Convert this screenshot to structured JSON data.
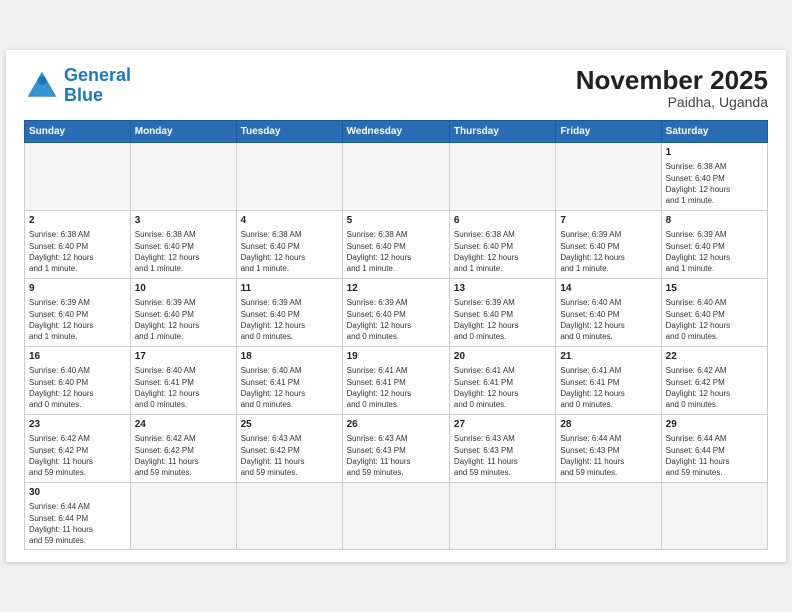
{
  "header": {
    "logo_general": "General",
    "logo_blue": "Blue",
    "title": "November 2025",
    "subtitle": "Paidha, Uganda"
  },
  "weekdays": [
    "Sunday",
    "Monday",
    "Tuesday",
    "Wednesday",
    "Thursday",
    "Friday",
    "Saturday"
  ],
  "weeks": [
    [
      {
        "day": "",
        "text": ""
      },
      {
        "day": "",
        "text": ""
      },
      {
        "day": "",
        "text": ""
      },
      {
        "day": "",
        "text": ""
      },
      {
        "day": "",
        "text": ""
      },
      {
        "day": "",
        "text": ""
      },
      {
        "day": "1",
        "text": "Sunrise: 6:38 AM\nSunset: 6:40 PM\nDaylight: 12 hours\nand 1 minute."
      }
    ],
    [
      {
        "day": "2",
        "text": "Sunrise: 6:38 AM\nSunset: 6:40 PM\nDaylight: 12 hours\nand 1 minute."
      },
      {
        "day": "3",
        "text": "Sunrise: 6:38 AM\nSunset: 6:40 PM\nDaylight: 12 hours\nand 1 minute."
      },
      {
        "day": "4",
        "text": "Sunrise: 6:38 AM\nSunset: 6:40 PM\nDaylight: 12 hours\nand 1 minute."
      },
      {
        "day": "5",
        "text": "Sunrise: 6:38 AM\nSunset: 6:40 PM\nDaylight: 12 hours\nand 1 minute."
      },
      {
        "day": "6",
        "text": "Sunrise: 6:38 AM\nSunset: 6:40 PM\nDaylight: 12 hours\nand 1 minute."
      },
      {
        "day": "7",
        "text": "Sunrise: 6:39 AM\nSunset: 6:40 PM\nDaylight: 12 hours\nand 1 minute."
      },
      {
        "day": "8",
        "text": "Sunrise: 6:39 AM\nSunset: 6:40 PM\nDaylight: 12 hours\nand 1 minute."
      }
    ],
    [
      {
        "day": "9",
        "text": "Sunrise: 6:39 AM\nSunset: 6:40 PM\nDaylight: 12 hours\nand 1 minute."
      },
      {
        "day": "10",
        "text": "Sunrise: 6:39 AM\nSunset: 6:40 PM\nDaylight: 12 hours\nand 1 minute."
      },
      {
        "day": "11",
        "text": "Sunrise: 6:39 AM\nSunset: 6:40 PM\nDaylight: 12 hours\nand 0 minutes."
      },
      {
        "day": "12",
        "text": "Sunrise: 6:39 AM\nSunset: 6:40 PM\nDaylight: 12 hours\nand 0 minutes."
      },
      {
        "day": "13",
        "text": "Sunrise: 6:39 AM\nSunset: 6:40 PM\nDaylight: 12 hours\nand 0 minutes."
      },
      {
        "day": "14",
        "text": "Sunrise: 6:40 AM\nSunset: 6:40 PM\nDaylight: 12 hours\nand 0 minutes."
      },
      {
        "day": "15",
        "text": "Sunrise: 6:40 AM\nSunset: 6:40 PM\nDaylight: 12 hours\nand 0 minutes."
      }
    ],
    [
      {
        "day": "16",
        "text": "Sunrise: 6:40 AM\nSunset: 6:40 PM\nDaylight: 12 hours\nand 0 minutes."
      },
      {
        "day": "17",
        "text": "Sunrise: 6:40 AM\nSunset: 6:41 PM\nDaylight: 12 hours\nand 0 minutes."
      },
      {
        "day": "18",
        "text": "Sunrise: 6:40 AM\nSunset: 6:41 PM\nDaylight: 12 hours\nand 0 minutes."
      },
      {
        "day": "19",
        "text": "Sunrise: 6:41 AM\nSunset: 6:41 PM\nDaylight: 12 hours\nand 0 minutes."
      },
      {
        "day": "20",
        "text": "Sunrise: 6:41 AM\nSunset: 6:41 PM\nDaylight: 12 hours\nand 0 minutes."
      },
      {
        "day": "21",
        "text": "Sunrise: 6:41 AM\nSunset: 6:41 PM\nDaylight: 12 hours\nand 0 minutes."
      },
      {
        "day": "22",
        "text": "Sunrise: 6:42 AM\nSunset: 6:42 PM\nDaylight: 12 hours\nand 0 minutes."
      }
    ],
    [
      {
        "day": "23",
        "text": "Sunrise: 6:42 AM\nSunset: 6:42 PM\nDaylight: 11 hours\nand 59 minutes."
      },
      {
        "day": "24",
        "text": "Sunrise: 6:42 AM\nSunset: 6:42 PM\nDaylight: 11 hours\nand 59 minutes."
      },
      {
        "day": "25",
        "text": "Sunrise: 6:43 AM\nSunset: 6:42 PM\nDaylight: 11 hours\nand 59 minutes."
      },
      {
        "day": "26",
        "text": "Sunrise: 6:43 AM\nSunset: 6:43 PM\nDaylight: 11 hours\nand 59 minutes."
      },
      {
        "day": "27",
        "text": "Sunrise: 6:43 AM\nSunset: 6:43 PM\nDaylight: 11 hours\nand 59 minutes."
      },
      {
        "day": "28",
        "text": "Sunrise: 6:44 AM\nSunset: 6:43 PM\nDaylight: 11 hours\nand 59 minutes."
      },
      {
        "day": "29",
        "text": "Sunrise: 6:44 AM\nSunset: 6:44 PM\nDaylight: 11 hours\nand 59 minutes."
      }
    ],
    [
      {
        "day": "30",
        "text": "Sunrise: 6:44 AM\nSunset: 6:44 PM\nDaylight: 11 hours\nand 59 minutes."
      },
      {
        "day": "",
        "text": ""
      },
      {
        "day": "",
        "text": ""
      },
      {
        "day": "",
        "text": ""
      },
      {
        "day": "",
        "text": ""
      },
      {
        "day": "",
        "text": ""
      },
      {
        "day": "",
        "text": ""
      }
    ]
  ]
}
